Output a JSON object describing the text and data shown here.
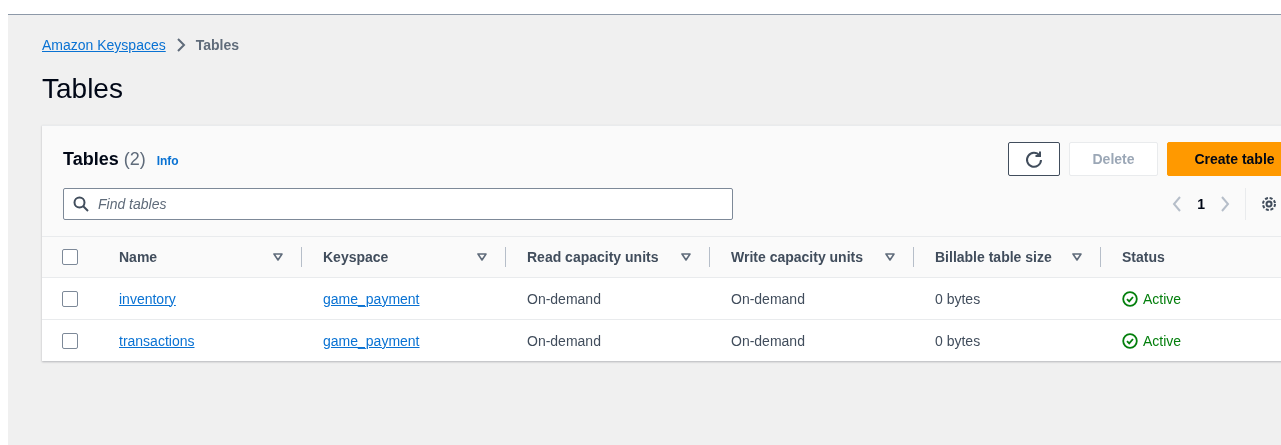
{
  "breadcrumb": [
    {
      "label": "Amazon Keyspaces",
      "link": true
    },
    {
      "label": "Tables",
      "link": false
    }
  ],
  "page_title": "Tables",
  "table_panel": {
    "title": "Tables",
    "count": "(2)",
    "info": "Info",
    "buttons": [
      {
        "kind": "refresh",
        "disabled": false
      },
      {
        "kind": "normal",
        "label": "Delete",
        "disabled": true
      },
      {
        "kind": "primary",
        "label": "Create table",
        "disabled": false
      }
    ],
    "search": {
      "placeholder": "Find tables"
    },
    "select_all_checked": false,
    "pagination": {
      "page": "1"
    },
    "columns": [
      {
        "label": "Name",
        "sortable": true
      },
      {
        "label": "Keyspace",
        "sortable": true
      },
      {
        "label": "Read capacity units",
        "sortable": true
      },
      {
        "label": "Write capacity units",
        "sortable": true
      },
      {
        "label": "Billable table size",
        "sortable": true
      },
      {
        "label": "Status",
        "sortable": false
      }
    ],
    "rows": [
      {
        "selected": false,
        "name": "inventory",
        "keyspace": "game_payment",
        "read": "On-demand",
        "write": "On-demand",
        "size": "0 bytes",
        "status": "Active"
      },
      {
        "selected": false,
        "name": "transactions",
        "keyspace": "game_payment",
        "read": "On-demand",
        "write": "On-demand",
        "size": "0 bytes",
        "status": "Active"
      }
    ]
  }
}
